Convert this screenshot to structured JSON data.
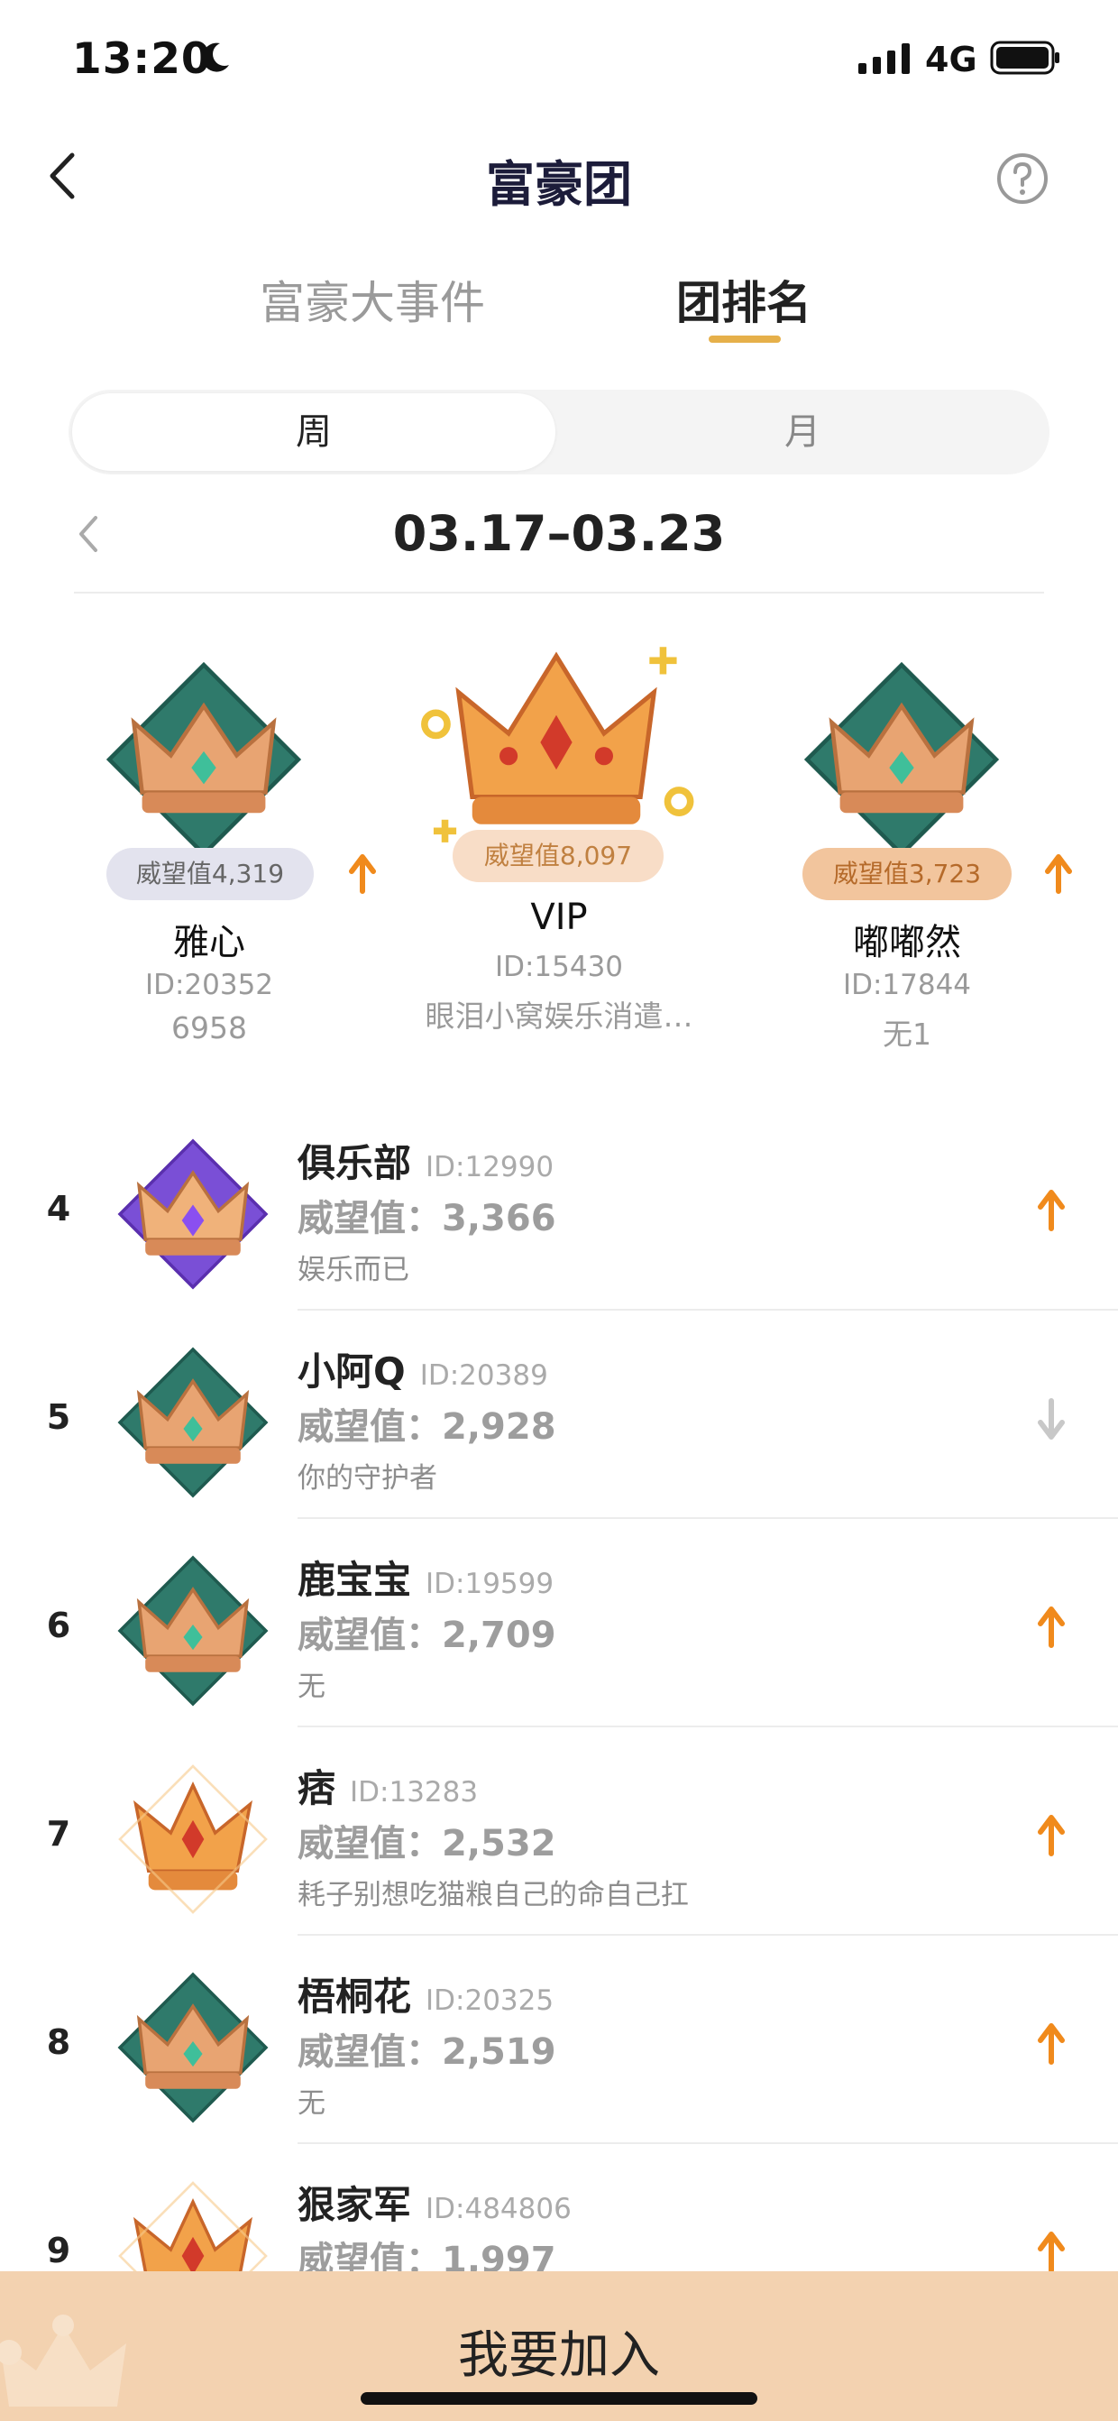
{
  "status_bar": {
    "time": "13:20",
    "network": "4G"
  },
  "header": {
    "title": "富豪团"
  },
  "tabs": [
    {
      "label": "富豪大事件"
    },
    {
      "label": "团排名"
    }
  ],
  "period": {
    "week": "周",
    "month": "月"
  },
  "date_range": "03.17–03.23",
  "podium": [
    {
      "rank": 2,
      "score": "威望值4,319",
      "name": "雅心",
      "id": "ID:20352",
      "sub": "6958",
      "trend": "up"
    },
    {
      "rank": 1,
      "score": "威望值8,097",
      "name": "VIP",
      "id": "ID:15430",
      "sub": "眼泪小窝娱乐消遣…",
      "trend": "none"
    },
    {
      "rank": 3,
      "score": "威望值3,723",
      "name": "嘟嘟然",
      "id": "ID:17844",
      "sub": "无1",
      "trend": "up"
    }
  ],
  "ranking": [
    {
      "rank": "4",
      "name": "俱乐部",
      "id": "ID:12990",
      "score": "威望值：3,366",
      "desc": "娱乐而已",
      "trend": "up",
      "badge": "purple"
    },
    {
      "rank": "5",
      "name": "小阿Q",
      "id": "ID:20389",
      "score": "威望值：2,928",
      "desc": "你的守护者",
      "trend": "down",
      "badge": "teal"
    },
    {
      "rank": "6",
      "name": "鹿宝宝",
      "id": "ID:19599",
      "score": "威望值：2,709",
      "desc": "无",
      "trend": "up",
      "badge": "teal"
    },
    {
      "rank": "7",
      "name": "痞",
      "id": "ID:13283",
      "score": "威望值：2,532",
      "desc": "耗子别想吃猫粮自己的命自己扛",
      "trend": "up",
      "badge": "gold"
    },
    {
      "rank": "8",
      "name": "梧桐花",
      "id": "ID:20325",
      "score": "威望值：2,519",
      "desc": "无",
      "trend": "up",
      "badge": "teal"
    },
    {
      "rank": "9",
      "name": "狠家军",
      "id": "ID:484806",
      "score": "威望值：1,997",
      "desc": "",
      "trend": "up",
      "badge": "gold"
    }
  ],
  "join_button": {
    "label": "我要加入"
  },
  "colors": {
    "accent": "#e6b04a",
    "arrow_up": "#f08a1c",
    "arrow_down": "#c8c8c8",
    "join_bar": "#f3d2b0"
  },
  "icons": [
    "moon-icon",
    "signal-icon",
    "battery-icon",
    "back-chevron-icon",
    "help-icon",
    "crown-badge-icon",
    "arrow-up-icon",
    "arrow-down-icon"
  ]
}
